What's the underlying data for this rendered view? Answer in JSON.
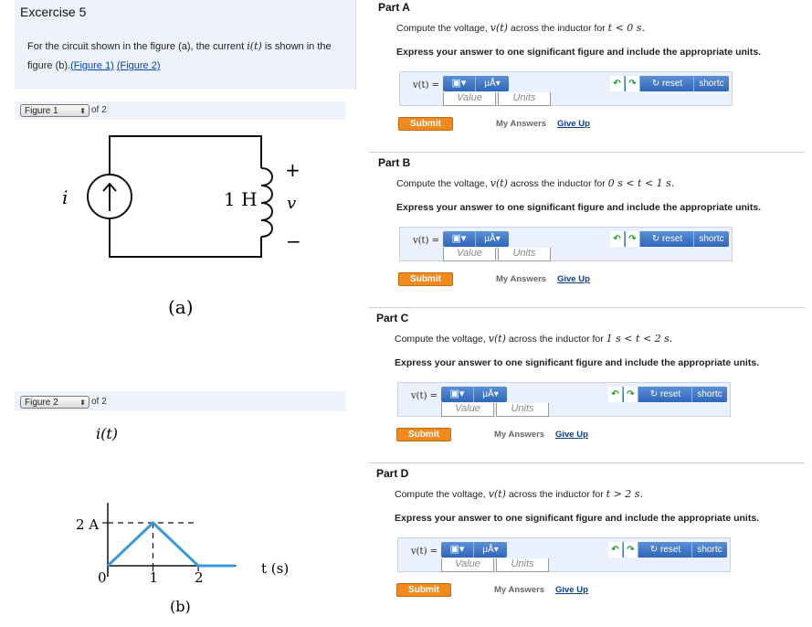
{
  "exercise": {
    "title": "Excercise 5",
    "intro_before": "For the circuit shown in the figure (a), the current ",
    "intro_math": "i(t)",
    "intro_after": " is shown in the figure (b).",
    "link1": "(Figure 1)",
    "link2": "(Figure 2)"
  },
  "figure1": {
    "selector": "Figure 1",
    "of_text": "of 2",
    "current_label": "i",
    "inductor_label": "1 H",
    "plus": "+",
    "minus": "−",
    "voltage_label": "v",
    "caption": "(a)"
  },
  "figure2": {
    "selector": "Figure 2",
    "of_text": "of 2",
    "y_label": "i(t)",
    "y_tick": "2 A",
    "x_ticks": [
      "0",
      "1",
      "2"
    ],
    "x_label": "t (s)",
    "caption": "(b)"
  },
  "chart_data": {
    "type": "line",
    "title": "",
    "xlabel": "t (s)",
    "ylabel": "i(t)",
    "x": [
      0,
      1,
      2,
      2.8
    ],
    "y": [
      0,
      2,
      0,
      0
    ],
    "xlim": [
      0,
      3
    ],
    "ylim": [
      0,
      2.5
    ],
    "grid": false,
    "series_color": "#3a9ad9"
  },
  "toolbar": {
    "templates_icon": "templates-icon",
    "units_button": "μÅ",
    "undo_icon": "undo-icon",
    "redo_icon": "redo-icon",
    "reset_label": "reset",
    "shortcuts_label": "shortc",
    "value_placeholder": "Value",
    "units_placeholder": "Units"
  },
  "common": {
    "answer_label": "v(t) =",
    "submit": "Submit",
    "my_answers": "My Answers",
    "give_up": "Give Up",
    "instruction": "Express your answer to one significant figure and include the appropriate units.",
    "question_prefix": "Compute the voltage, ",
    "question_math": "v(t)",
    "question_mid": " across the inductor for "
  },
  "parts": [
    {
      "title": "Part A",
      "condition": "t < 0 s."
    },
    {
      "title": "Part B",
      "condition": "0 s < t < 1 s."
    },
    {
      "title": "Part C",
      "condition": "1 s < t < 2 s."
    },
    {
      "title": "Part D",
      "condition": "t > 2 s."
    }
  ],
  "colors": {
    "accent": "#2f66b8",
    "submit": "#f08a1e",
    "panel": "#eef3fb",
    "plot_line": "#3a9ad9"
  }
}
